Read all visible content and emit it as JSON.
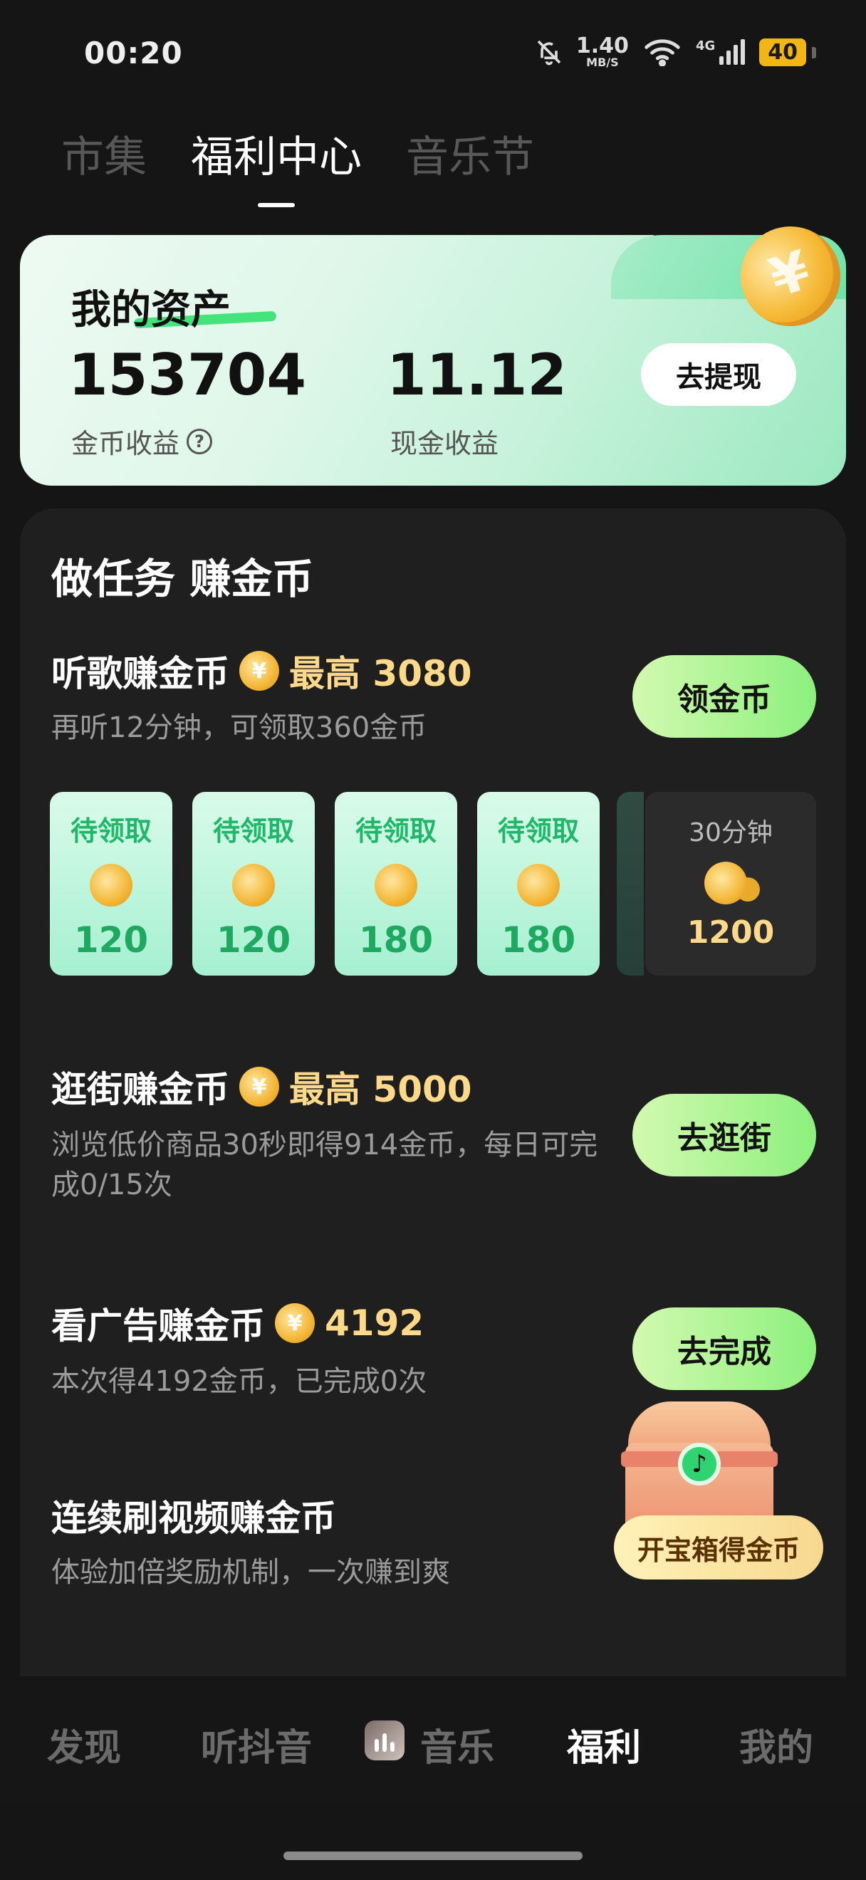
{
  "status_bar": {
    "time": "00:20",
    "net_speed_value": "1.40",
    "net_speed_unit": "MB/S",
    "network": "4G",
    "battery": "40"
  },
  "top_tabs": [
    {
      "label": "市集",
      "active": false
    },
    {
      "label": "福利中心",
      "active": true
    },
    {
      "label": "音乐节",
      "active": false
    }
  ],
  "assets": {
    "title": "我的资产",
    "coin_value": "153704",
    "coin_label": "金币收益",
    "help_symbol": "?",
    "cash_value": "11.12",
    "cash_label": "现金收益",
    "withdraw_label": "去提现"
  },
  "tasks": {
    "heading": "做任务 赚金币",
    "listen": {
      "title": "听歌赚金币",
      "highlight": "最高 3080",
      "desc": "再听12分钟，可领取360金币",
      "button": "领金币",
      "tiles": [
        {
          "label": "待领取",
          "value": "120"
        },
        {
          "label": "待领取",
          "value": "120"
        },
        {
          "label": "待领取",
          "value": "180"
        },
        {
          "label": "待领取",
          "value": "180"
        }
      ],
      "big_tile": {
        "label": "30分钟",
        "value": "1200"
      }
    },
    "shop": {
      "title": "逛街赚金币",
      "highlight": "最高 5000",
      "desc": "浏览低价商品30秒即得914金币，每日可完成0/15次",
      "button": "去逛街"
    },
    "ads": {
      "title": "看广告赚金币",
      "highlight": "4192",
      "desc": "本次得4192金币，已完成0次",
      "button": "去完成"
    },
    "video": {
      "title": "连续刷视频赚金币",
      "desc": "体验加倍奖励机制，一次赚到爽"
    },
    "chest_button": "开宝箱得金币"
  },
  "bottom_nav": [
    {
      "label": "发现",
      "active": false
    },
    {
      "label": "听抖音",
      "active": false
    },
    {
      "label": "音乐",
      "active": false
    },
    {
      "label": "福利",
      "active": true
    },
    {
      "label": "我的",
      "active": false
    }
  ],
  "colors": {
    "background": "#151515",
    "panel": "#1f1f1f",
    "accent_green": "#8df07d",
    "coin_text": "#ffd98a"
  },
  "icons": [
    "mute-bell-icon",
    "wifi-icon",
    "signal-icon",
    "battery-icon",
    "help-icon",
    "coin-icon",
    "treasure-chest-icon",
    "music-app-icon"
  ]
}
